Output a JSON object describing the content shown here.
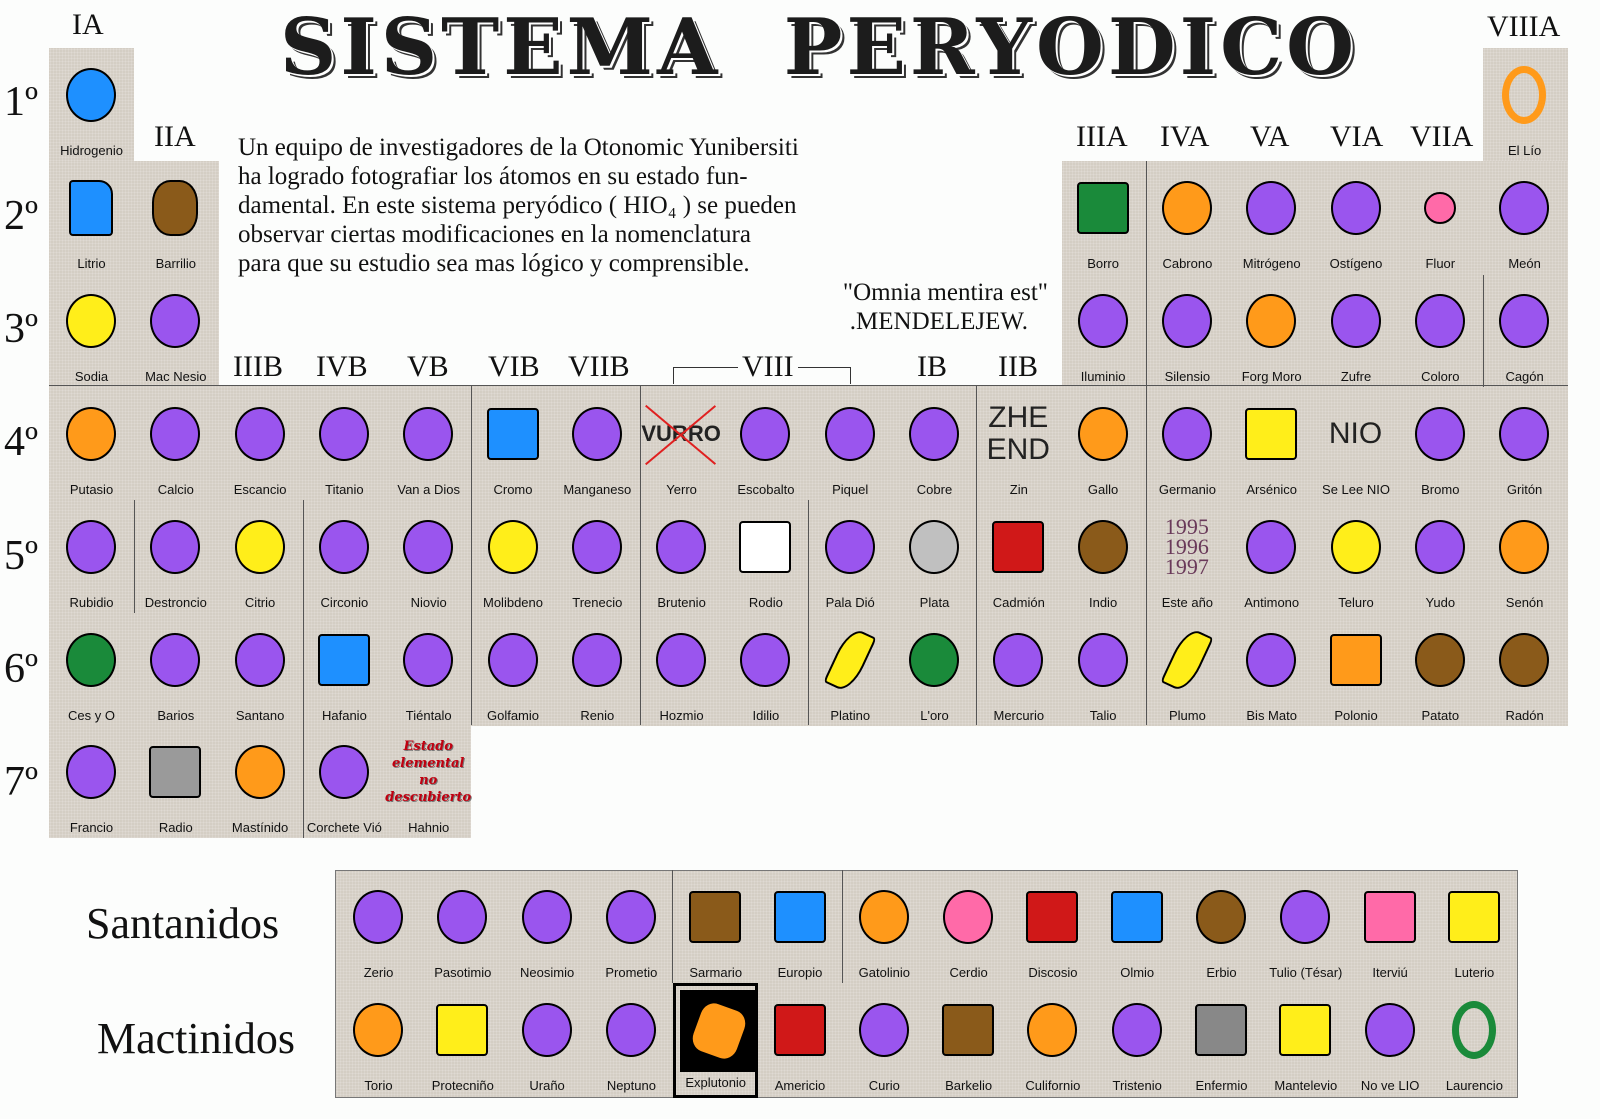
{
  "title": "SISTEMA  PERYODICO",
  "groups": {
    "IA": "IA",
    "IIA": "IIA",
    "IIIA": "IIIA",
    "IVA": "IVA",
    "VA": "VA",
    "VIA": "VIA",
    "VIIA": "VIIA",
    "VIIIA": "VIIIA",
    "IIIB": "IIIB",
    "IVB": "IVB",
    "VB": "VB",
    "VIB": "VIB",
    "VIIB": "VIIB",
    "VIII": "VIII",
    "IB": "IB",
    "IIB": "IIB"
  },
  "periods": [
    "1º",
    "2º",
    "3º",
    "4º",
    "5º",
    "6º",
    "7º"
  ],
  "intro": {
    "lines": [
      "Un equipo de investigadores de la Otonomic Yunibersiti",
      "ha logrado  fotografiar los átomos en su estado fun-",
      "damental. En este sistema peryódico  ( HIO₄ )  se pueden",
      "observar  ciertas  modificaciones  en  la  nomenclatura",
      "para que su estudio sea mas lógico  y comprensible."
    ],
    "quote": "\"Omnia mentira est\"",
    "author": ".MENDELEJEW."
  },
  "elements": {
    "p1": [
      "Hidrogenio",
      "El Lío"
    ],
    "p2": [
      "Litrio",
      "Barrilio",
      "Borro",
      "Cabrono",
      "Mitrógeno",
      "Ostígeno",
      "Fluor",
      "Meón"
    ],
    "p3": [
      "Sodia",
      "Mac Nesio",
      "Iluminio",
      "Silensio",
      "Forg Moro",
      "Zufre",
      "Coloro",
      "Cagón"
    ],
    "p4": [
      "Putasio",
      "Calcio",
      "Escancio",
      "Titanio",
      "Van a Dios",
      "Cromo",
      "Manganeso",
      "Yerro",
      "Escobalto",
      "Piquel",
      "Cobre",
      "Zin",
      "Gallo",
      "Germanio",
      "Arsénico",
      "Se Lee NIO",
      "Bromo",
      "Gritón"
    ],
    "p5": [
      "Rubidio",
      "Destroncio",
      "Citrio",
      "Circonio",
      "Niovio",
      "Molibdeno",
      "Trenecio",
      "Brutenio",
      "Rodio",
      "Pala Dió",
      "Plata",
      "Cadmión",
      "Indio",
      "Este año",
      "Antimono",
      "Teluro",
      "Yudo",
      "Senón"
    ],
    "p6": [
      "Ces y O",
      "Barios",
      "Santano",
      "Hafanio",
      "Tiéntalo",
      "Golfamio",
      "Renio",
      "Hozmio",
      "Idilio",
      "Platino",
      "L'oro",
      "Mercurio",
      "Talio",
      "Plumo",
      "Bis Mato",
      "Polonio",
      "Patato",
      "Radón"
    ],
    "p7": [
      "Francio",
      "Radio",
      "Mastínido",
      "Corchete Vió",
      "Hahnio"
    ]
  },
  "picture_texts": {
    "yerro": "VURRO",
    "zin": "ZHE END",
    "selee": "NIO",
    "esteano": [
      "1995",
      "1996",
      "1997"
    ],
    "hahnio": [
      "Estado",
      "elemental",
      "no",
      "descubierto"
    ]
  },
  "series": {
    "santanidos_label": "Santanidos",
    "mactinidos_label": "Mactinidos",
    "santanidos": [
      "Zerio",
      "Pasotimio",
      "Neosimio",
      "Prometio",
      "Sarmario",
      "Europio",
      "Gatolinio",
      "Cerdio",
      "Discosio",
      "Olmio",
      "Erbio",
      "Tulio (Tésar)",
      "Iterviú",
      "Luterio"
    ],
    "mactinidos": [
      "Torio",
      "Protecniño",
      "Uraño",
      "Neptuno",
      "Explutonio",
      "Americio",
      "Curio",
      "Barkelio",
      "Culifornio",
      "Tristenio",
      "Enfermio",
      "Mantelevio",
      "No ve LIO",
      "Laurencio"
    ]
  },
  "colors": {
    "cell_bg": "#d4cec4",
    "purple": "#9a55ee",
    "orange": "#ff9a1a",
    "yellow": "#ffee1a",
    "blue": "#1e90ff",
    "brown": "#8a5a1a",
    "green": "#1a8a3a",
    "red": "#d01818",
    "pink": "#ff6aa8"
  }
}
